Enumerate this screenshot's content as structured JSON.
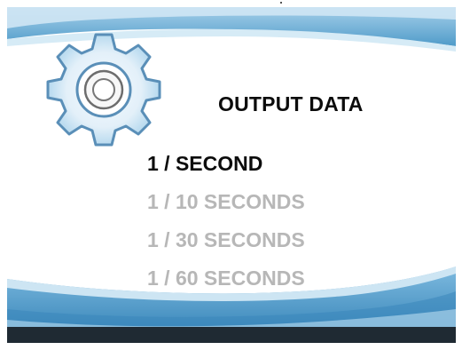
{
  "screen": {
    "title": "OUTPUT DATA",
    "menu": [
      {
        "label": "1 / SECOND",
        "selected": true
      },
      {
        "label": "1 / 10 SECONDS",
        "selected": false
      },
      {
        "label": "1 / 30 SECONDS",
        "selected": false
      },
      {
        "label": "1 / 60 SECONDS",
        "selected": false
      }
    ]
  },
  "icons": {
    "header_icon": "gear-icon"
  },
  "colors": {
    "selected_text": "#0c0c0c",
    "unselected_text": "#b7b7b7",
    "accent_blue": "#5fa8d3",
    "frame": "#1f2a33"
  }
}
